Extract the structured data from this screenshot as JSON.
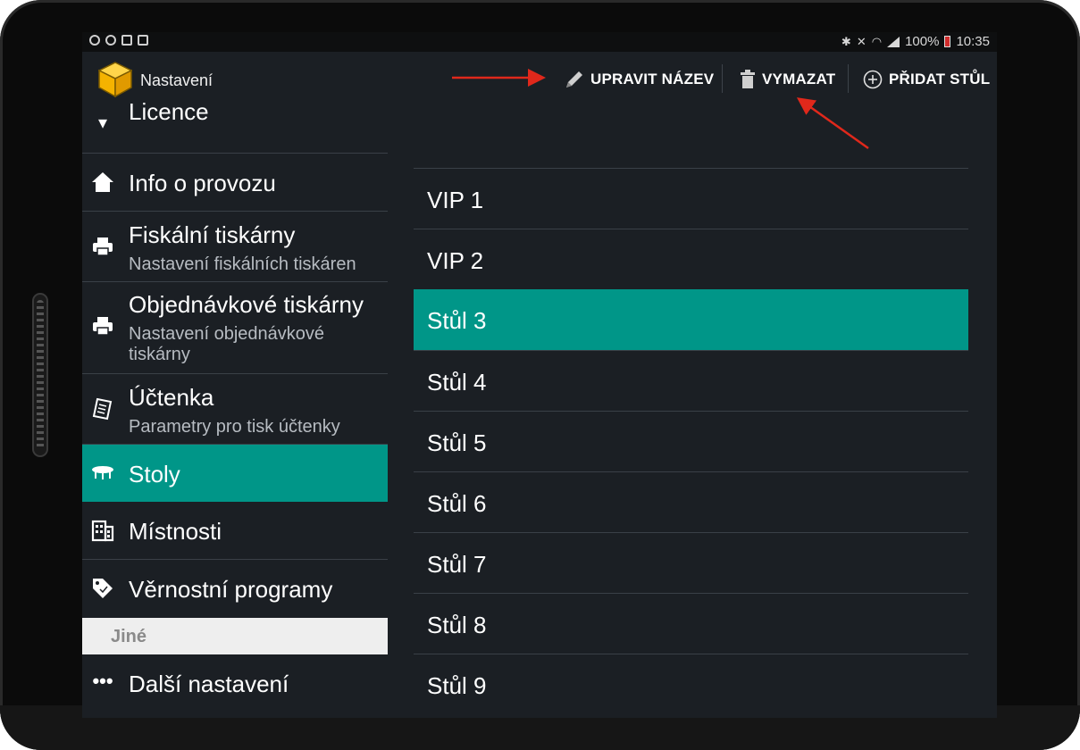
{
  "status_bar": {
    "battery": "100%",
    "time": "10:35"
  },
  "app": {
    "title": "Nastavení"
  },
  "actions": {
    "rename": "UPRAVIT NÁZEV",
    "delete": "VYMAZAT",
    "add": "PŘIDAT STŮL"
  },
  "sidebar": {
    "partial_top": "Licence",
    "items": [
      {
        "label": "Info o provozu",
        "icon": "home-icon"
      },
      {
        "label": "Fiskální tiskárny",
        "sub": "Nastavení fiskálních tiskáren",
        "icon": "printer-icon"
      },
      {
        "label": "Objednávkové tiskárny",
        "sub1": "Nastavení objednávkové",
        "sub2": "tiskárny",
        "icon": "printer-icon"
      },
      {
        "label": "Účtenka",
        "sub": "Parametry pro tisk účtenky",
        "icon": "receipt-icon"
      },
      {
        "label": "Stoly",
        "icon": "table-icon",
        "active": true
      },
      {
        "label": "Místnosti",
        "icon": "building-icon"
      },
      {
        "label": "Věrnostní programy",
        "icon": "tag-icon"
      }
    ],
    "section_header": "Jiné",
    "more": {
      "label": "Další nastavení",
      "icon": "more-dots-icon"
    }
  },
  "tables": [
    {
      "label": "VIP 1"
    },
    {
      "label": "VIP 2"
    },
    {
      "label": "Stůl 3",
      "selected": true
    },
    {
      "label": "Stůl 4"
    },
    {
      "label": "Stůl 5"
    },
    {
      "label": "Stůl 6"
    },
    {
      "label": "Stůl 7"
    },
    {
      "label": "Stůl 8"
    },
    {
      "label": "Stůl 9"
    }
  ],
  "colors": {
    "accent": "#009688",
    "background": "#1b1f24",
    "annotation_arrow": "#e0281b"
  }
}
